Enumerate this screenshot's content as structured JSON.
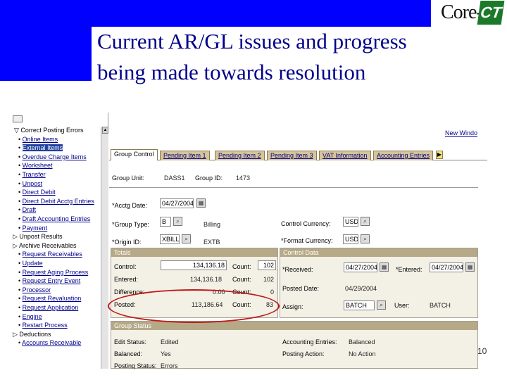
{
  "slide": {
    "title_line1": "Current AR/GL issues and progress",
    "title_line2": "being made towards resolution",
    "logo_text": "Core-",
    "logo_ct": "CT",
    "page_number": "10"
  },
  "nav": {
    "items": [
      {
        "label": "Correct Posting Errors",
        "indent": 18,
        "type": "folder-open"
      },
      {
        "label": "Online Items",
        "indent": 24,
        "type": "link"
      },
      {
        "label": "External Items",
        "indent": 24,
        "type": "selected"
      },
      {
        "label": "Overdue Charge Items",
        "indent": 24,
        "type": "link"
      },
      {
        "label": "Worksheet",
        "indent": 24,
        "type": "link"
      },
      {
        "label": "Transfer",
        "indent": 24,
        "type": "link"
      },
      {
        "label": "Unpost",
        "indent": 24,
        "type": "link"
      },
      {
        "label": "Direct Debit",
        "indent": 24,
        "type": "link"
      },
      {
        "label": "Direct Debit Acctg Entries",
        "indent": 24,
        "type": "link"
      },
      {
        "label": "Draft",
        "indent": 24,
        "type": "link"
      },
      {
        "label": "Draft Accounting Entries",
        "indent": 24,
        "type": "link"
      },
      {
        "label": "Payment",
        "indent": 24,
        "type": "link"
      },
      {
        "label": "Unpost Results",
        "indent": 16,
        "type": "folder"
      },
      {
        "label": "Archive Receivables",
        "indent": 16,
        "type": "folder"
      },
      {
        "label": "Request Receivables",
        "indent": 24,
        "type": "link"
      },
      {
        "label": "Update",
        "indent": 24,
        "type": "link"
      },
      {
        "label": "Request Aging Process",
        "indent": 24,
        "type": "link"
      },
      {
        "label": "Request Entry Event",
        "indent": 24,
        "type": "link"
      },
      {
        "label": "Processor",
        "indent": 24,
        "type": "link"
      },
      {
        "label": "Request Revaluation",
        "indent": 24,
        "type": "link"
      },
      {
        "label": "Request Application",
        "indent": 24,
        "type": "link"
      },
      {
        "label": "Engine",
        "indent": 24,
        "type": "link"
      },
      {
        "label": "Restart Process",
        "indent": 24,
        "type": "link"
      },
      {
        "label": "Deductions",
        "indent": 16,
        "type": "folder"
      },
      {
        "label": "Accounts Receivable",
        "indent": 24,
        "type": "link"
      }
    ]
  },
  "main": {
    "new_window": "New Windo",
    "tabs": [
      {
        "label": "Group Control",
        "active": true
      },
      {
        "label": "Pending Item 1",
        "active": false
      },
      {
        "label": "Pending Item 2",
        "active": false
      },
      {
        "label": "Pending Item 3",
        "active": false
      },
      {
        "label": "VAT Information",
        "active": false
      },
      {
        "label": "Accounting Entries",
        "active": false
      }
    ],
    "group_unit_label": "Group Unit:",
    "group_unit": "DASS1",
    "group_id_label": "Group ID:",
    "group_id": "1473",
    "acctg_date_label": "*Acctg Date:",
    "acctg_date": "04/27/2004",
    "group_type_label": "*Group Type:",
    "group_type": "B",
    "group_type_desc": "Billing",
    "origin_id_label": "*Origin ID:",
    "origin_id": "XBILL",
    "origin_desc": "EXTB",
    "control_currency_label": "Control Currency:",
    "control_currency": "USD",
    "format_currency_label": "*Format Currency:",
    "format_currency": "USD",
    "totals": {
      "header": "Totals",
      "control_label": "Control:",
      "control_amount": "134,136.18",
      "control_count": "102",
      "entered_label": "Entered:",
      "entered_amount": "134,136.18",
      "entered_count": "102",
      "difference_label": "Difference:",
      "difference_amount": "0.00",
      "difference_count": "0",
      "posted_label": "Posted:",
      "posted_amount": "113,186.64",
      "posted_count": "83",
      "count_label": "Count:"
    },
    "control_data": {
      "header": "Control Data",
      "received_label": "*Received:",
      "received": "04/27/2004",
      "entered_label": "*Entered:",
      "entered": "04/27/2004",
      "posted_date_label": "Posted Date:",
      "posted_date": "04/29/2004",
      "assign_label": "Assign:",
      "assign": "BATCH",
      "user_label": "User:",
      "user": "BATCH"
    },
    "group_status": {
      "header": "Group Status",
      "edit_status_label": "Edit Status:",
      "edit_status": "Edited",
      "balanced_label": "Balanced:",
      "balanced": "Yes",
      "posting_status_label": "Posting Status:",
      "posting_status": "Errors",
      "accounting_entries_label": "Accounting Entries:",
      "accounting_entries": "Balanced",
      "posting_action_label": "Posting Action:",
      "posting_action": "No Action"
    }
  },
  "colors": {
    "header_blue": "#0000ff",
    "title_text": "#00008b",
    "highlight_ellipse": "#c01818"
  }
}
